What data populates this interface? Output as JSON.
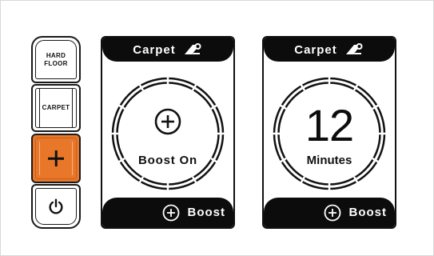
{
  "controls": {
    "hard_floor": {
      "line1": "HARD",
      "line2": "FLOOR",
      "icon": null
    },
    "carpet": {
      "label": "CARPET"
    },
    "boost": {
      "icon": "plus-icon",
      "accent": "#e8772a"
    },
    "power": {
      "icon": "power-icon"
    }
  },
  "display_boost": {
    "top_label": "Carpet",
    "top_icon": "carpet-icon",
    "center_icon": "plus-circle-icon",
    "center_label": "Boost On",
    "bottom_icon": "plus-circle-icon",
    "bottom_label": "Boost"
  },
  "display_minutes": {
    "top_label": "Carpet",
    "top_icon": "carpet-icon",
    "value": "12",
    "unit_label": "Minutes",
    "bottom_icon": "plus-circle-icon",
    "bottom_label": "Boost"
  },
  "colors": {
    "accent": "#e8772a",
    "panel_bar": "#0c0c0c",
    "outline": "#111111"
  }
}
